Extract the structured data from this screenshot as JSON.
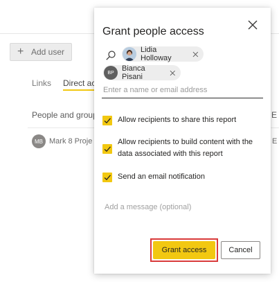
{
  "background": {
    "add_user_label": "Add user",
    "tabs": [
      {
        "label": "Links"
      },
      {
        "label": "Direct ac"
      }
    ],
    "columns": [
      "People and group",
      "E"
    ],
    "row": {
      "avatar_initials": "MB",
      "name": "Mark 8 Proje",
      "extra": "E"
    }
  },
  "dialog": {
    "title": "Grant people access",
    "chips": [
      {
        "name": "Lidia Holloway"
      },
      {
        "name": "Bianca Pisani",
        "initials": "BP"
      }
    ],
    "name_input": {
      "placeholder": "Enter a name or email address",
      "value": ""
    },
    "options": [
      {
        "label": "Allow recipients to share this report",
        "checked": true
      },
      {
        "label": "Allow recipients to build content with the data associated with this report",
        "checked": true
      },
      {
        "label": "Send an email notification",
        "checked": true
      }
    ],
    "message": {
      "placeholder": "Add a message (optional)"
    },
    "grant_label": "Grant access",
    "cancel_label": "Cancel"
  },
  "colors": {
    "accent": "#F2C811",
    "highlight_border": "#D93A3A"
  }
}
